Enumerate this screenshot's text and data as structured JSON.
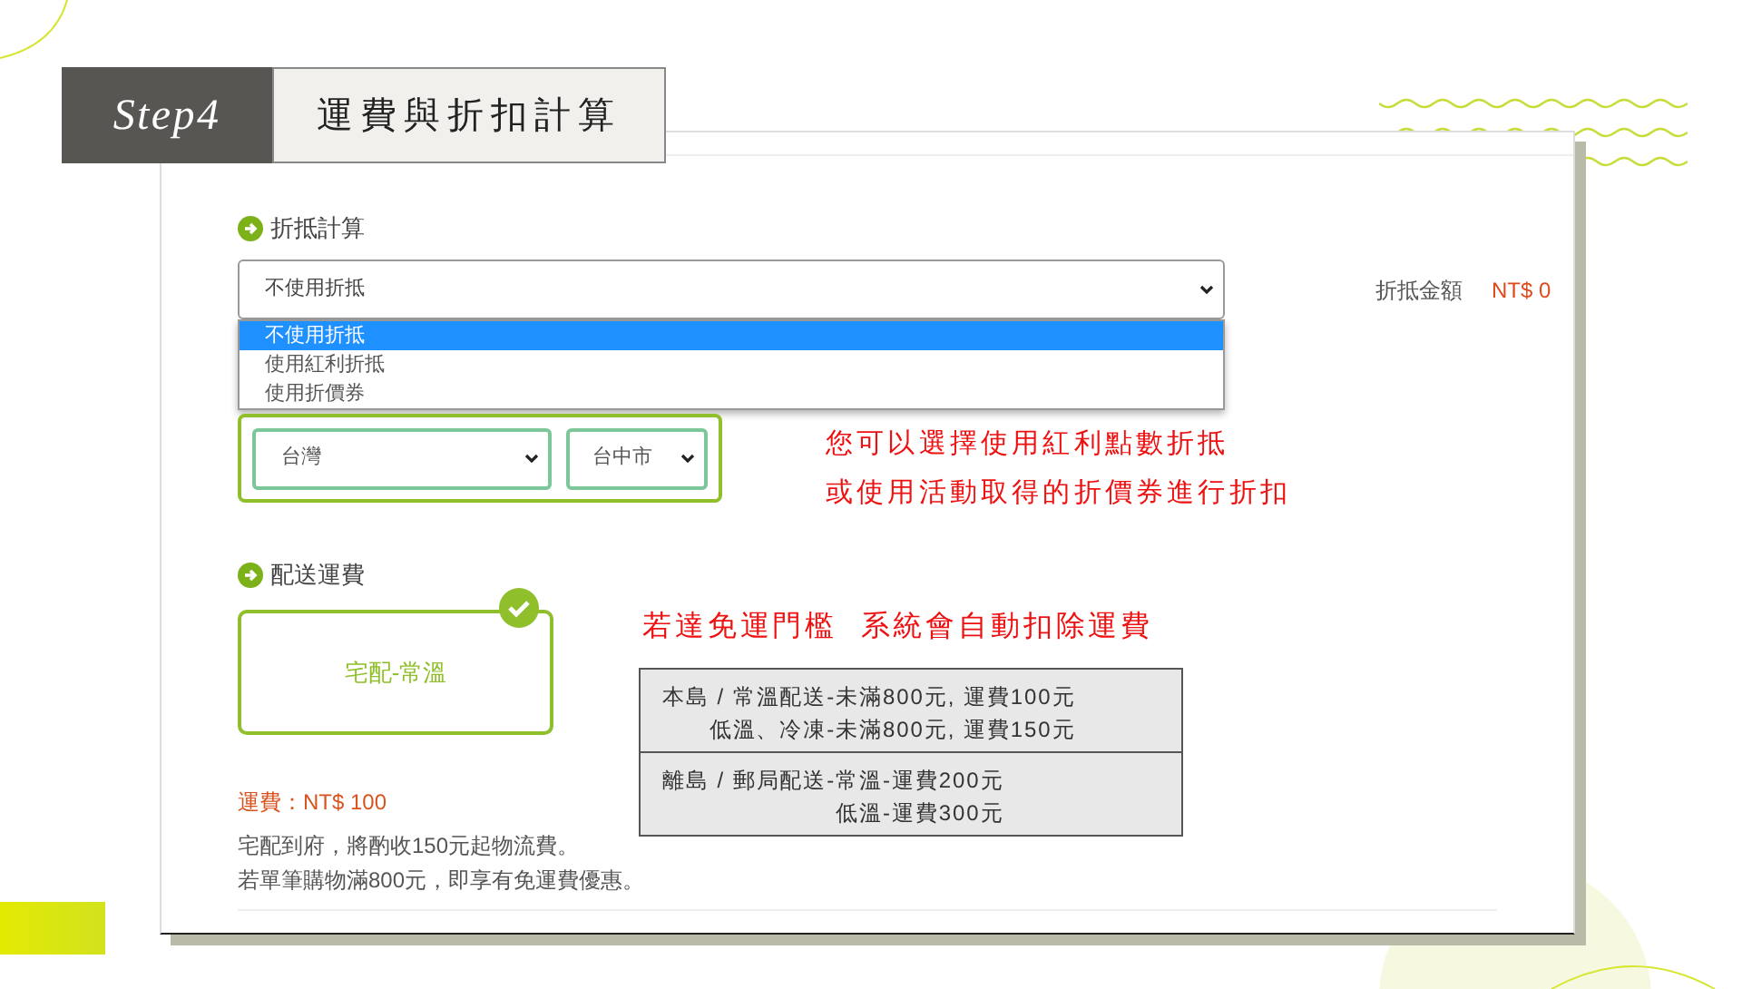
{
  "step": {
    "badge": "Step4",
    "title": "運費與折扣計算"
  },
  "discount": {
    "heading": "折抵計算",
    "value": "不使用折抵",
    "options": [
      {
        "label": "不使用折抵",
        "selected": true
      },
      {
        "label": "使用紅利折抵",
        "selected": false
      },
      {
        "label": "使用折價券",
        "selected": false
      }
    ],
    "amount_label": "折抵金額",
    "amount": "NT$ 0"
  },
  "region": {
    "country": "台灣",
    "city": "台中市"
  },
  "shipping": {
    "heading": "配送運費",
    "options": [
      {
        "label": "宅配-常溫",
        "selected": true
      }
    ],
    "fee": "運費：NT$ 100",
    "notes": [
      "宅配到府，將酌收150元起物流費。",
      "若單筆購物滿800元，即享有免運費優惠。"
    ]
  },
  "annotations": {
    "discount_note": [
      "您可以選擇使用紅利點數折抵",
      "或使用活動取得的折價券進行折扣"
    ],
    "free_shipping_note": "若達免運門檻  系統會自動扣除運費",
    "fee_table": [
      {
        "lines": [
          "本島 / 常溫配送-未滿800元, 運費100元",
          "低溫、冷凍-未滿800元, 運費150元"
        ]
      },
      {
        "lines": [
          "離島 / 郵局配送-常溫-運費200元",
          "低溫-運費300元"
        ]
      }
    ]
  }
}
